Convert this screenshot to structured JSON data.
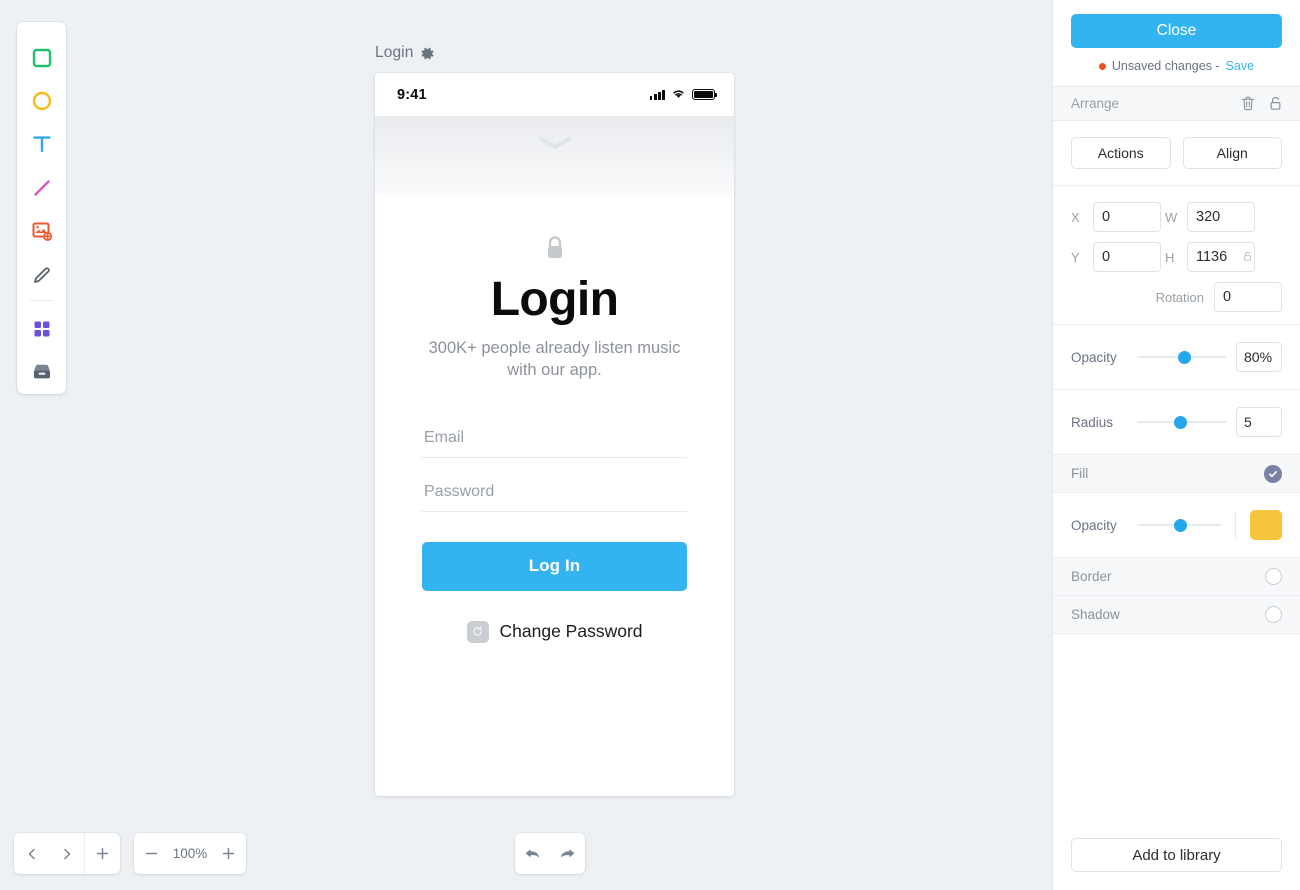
{
  "toolbar": {
    "items": [
      {
        "name": "rectangle-tool",
        "icon": "square-icon",
        "color": "#20c06a"
      },
      {
        "name": "ellipse-tool",
        "icon": "circle-icon",
        "color": "#f5bb1d"
      },
      {
        "name": "text-tool",
        "icon": "text-t-icon",
        "color": "#2fa8e8"
      },
      {
        "name": "line-tool",
        "icon": "line-icon",
        "color": "#d858c8"
      },
      {
        "name": "image-tool",
        "icon": "image-add-icon",
        "color": "#f4552a"
      },
      {
        "name": "pencil-tool",
        "icon": "pencil-icon",
        "color": "#5a6270"
      },
      {
        "name": "components-tool",
        "icon": "grid-squares-icon",
        "color": "#6b4fe0"
      },
      {
        "name": "library-tool",
        "icon": "archive-box-icon",
        "color": "#5a6270"
      }
    ]
  },
  "canvas": {
    "label": "Login",
    "gear_icon": "gear-icon"
  },
  "phone": {
    "statusbar": {
      "time": "9:41",
      "signal_icon": "signal-bars-icon",
      "wifi_icon": "wifi-icon",
      "battery_icon": "battery-icon"
    },
    "chevron_icon": "chevron-down-icon",
    "lock_icon": "lock-icon",
    "title": "Login",
    "subtitle": "300K+ people already listen music with our app.",
    "email_placeholder": "Email",
    "password_placeholder": "Password",
    "login_button": "Log In",
    "change_password_icon": "reset-icon",
    "change_password_label": "Change Password"
  },
  "bottom": {
    "prev_icon": "chevron-left-icon",
    "next_icon": "chevron-right-icon",
    "add_icon": "plus-icon",
    "zoom_out_icon": "minus-icon",
    "zoom_value": "100%",
    "zoom_in_icon": "plus-icon",
    "undo_icon": "undo-arrow-icon",
    "redo_icon": "redo-arrow-icon"
  },
  "panel": {
    "close_label": "Close",
    "status_text": "Unsaved changes -",
    "save_label": "Save",
    "status_dot_color": "#ef5126",
    "accent_color": "#34b3f1",
    "arrange": {
      "title": "Arrange",
      "delete_icon": "trash-icon",
      "lock_icon": "unlock-icon",
      "actions_label": "Actions",
      "align_label": "Align",
      "x_label": "X",
      "x_value": "0",
      "y_label": "Y",
      "y_value": "0",
      "w_label": "W",
      "w_value": "320",
      "h_label": "H",
      "h_value": "1136",
      "ratio_lock_icon": "link-lock-icon",
      "rotation_label": "Rotation",
      "rotation_value": "0"
    },
    "opacity": {
      "label": "Opacity",
      "value": "80%",
      "knob_pct": 46
    },
    "radius": {
      "label": "Radius",
      "value": "5",
      "knob_pct": 42
    },
    "fill": {
      "label": "Fill",
      "enabled_icon": "check-circle-icon",
      "opacity_label": "Opacity",
      "opacity_knob_pct": 44,
      "color": "#f5c53b"
    },
    "border": {
      "label": "Border",
      "toggle_icon": "empty-circle-icon"
    },
    "shadow": {
      "label": "Shadow",
      "toggle_icon": "empty-circle-icon"
    },
    "add_library_label": "Add to library"
  }
}
